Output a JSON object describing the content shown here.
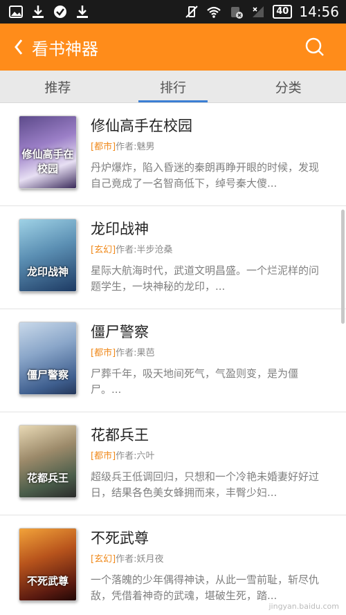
{
  "status": {
    "icons": [
      "image-icon",
      "download-icon",
      "check-circle-icon",
      "download-icon"
    ],
    "battery": "40",
    "time": "14:56"
  },
  "header": {
    "back_icon": "chevron-left-icon",
    "title": "看书神器",
    "search_icon": "search-icon"
  },
  "tabs": [
    {
      "label": "推荐"
    },
    {
      "label": "排行"
    },
    {
      "label": "分类"
    }
  ],
  "books": [
    {
      "title": "修仙高手在校园",
      "genre": "[都市]",
      "author": "作者:魅男",
      "desc": "丹炉爆炸，陷入昏迷的秦朗再睁开眼的时候，发现自己竟成了一名智商低下，绰号秦大傻...",
      "cover_text": "修仙高手在校园"
    },
    {
      "title": "龙印战神",
      "genre": "[玄幻]",
      "author": "作者:半步沧桑",
      "desc": "星际大航海时代，武道文明昌盛。一个烂泥样的问题学生，一块神秘的龙印，...",
      "cover_text": "龙印战神"
    },
    {
      "title": "僵尸警察",
      "genre": "[都市]",
      "author": "作者:果芭",
      "desc": "尸葬千年，吸天地间死气，气盈则变，是为僵尸。...",
      "cover_text": "僵尸警察"
    },
    {
      "title": "花都兵王",
      "genre": "[都市]",
      "author": "作者:六叶",
      "desc": "超级兵王低调回归，只想和一个冷艳未婚妻好好过日，结果各色美女蜂拥而来，丰臀少妇...",
      "cover_text": "花都兵王"
    },
    {
      "title": "不死武尊",
      "genre": "[玄幻]",
      "author": "作者:妖月夜",
      "desc": "一个落魄的少年偶得神诀，从此一雪前耻，斩尽仇敌，凭借着神奇的武魂，堪破生死，踏...",
      "cover_text": "不死武尊"
    }
  ],
  "watermark": "jingyan.baidu.com"
}
